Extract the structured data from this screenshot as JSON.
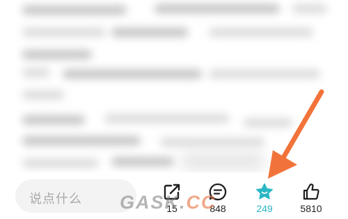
{
  "comment_input": {
    "placeholder": "说点什么"
  },
  "actions": {
    "share": {
      "icon": "share-icon",
      "count": "15"
    },
    "comments": {
      "icon": "comment-icon",
      "count": "848"
    },
    "favorite": {
      "icon": "star-icon",
      "count": "249",
      "color": "#29b7c5"
    },
    "like": {
      "icon": "thumbs-up-icon",
      "count": "5810"
    }
  },
  "annotation": {
    "arrow_color": "#f2733a"
  },
  "watermark": {
    "text_main": "GASK.",
    "text_accent": "CC"
  }
}
